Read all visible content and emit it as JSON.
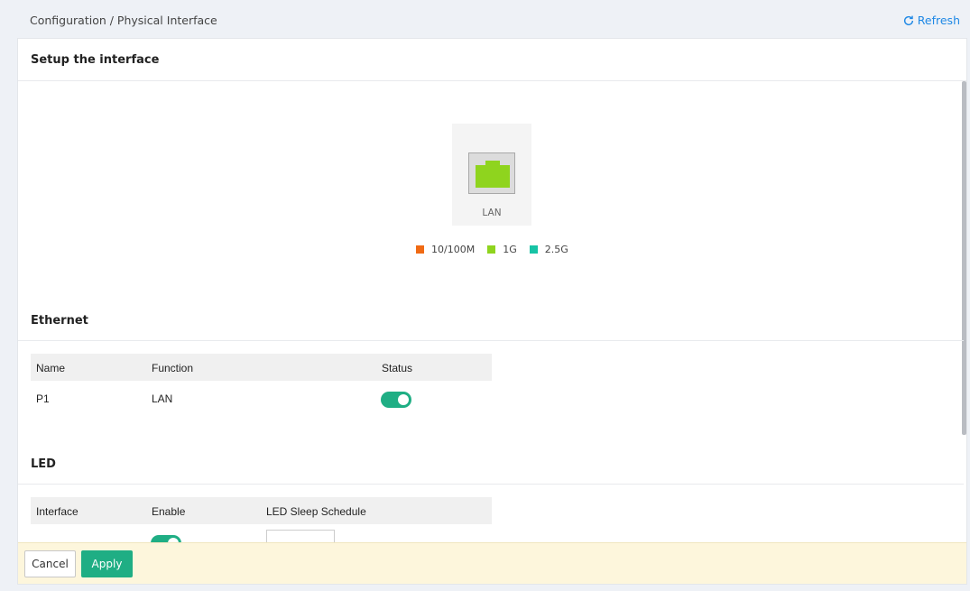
{
  "header": {
    "breadcrumb": "Configuration / Physical Interface",
    "refresh_label": "Refresh",
    "refresh_icon": "refresh-icon"
  },
  "panel": {
    "title": "Setup the interface"
  },
  "port": {
    "label": "LAN",
    "icon": "ethernet-port-icon",
    "color": "#8fd41e"
  },
  "legend": [
    {
      "label": "10/100M",
      "color": "#f06a14"
    },
    {
      "label": "1G",
      "color": "#8fd41e"
    },
    {
      "label": "2.5G",
      "color": "#17c3a5"
    }
  ],
  "ethernet": {
    "title": "Ethernet",
    "columns": [
      "Name",
      "Function",
      "Status"
    ],
    "rows": [
      {
        "name": "P1",
        "function": "LAN",
        "status_enabled": true
      }
    ]
  },
  "led": {
    "title": "LED",
    "columns": [
      "Interface",
      "Enable",
      "LED Sleep Schedule"
    ],
    "rows": [
      {
        "enable": true,
        "schedule": ""
      }
    ]
  },
  "footer": {
    "cancel_label": "Cancel",
    "apply_label": "Apply"
  },
  "colors": {
    "accent": "#1fae84",
    "link": "#1e88e5",
    "footer_bg": "#fdf6dc"
  }
}
